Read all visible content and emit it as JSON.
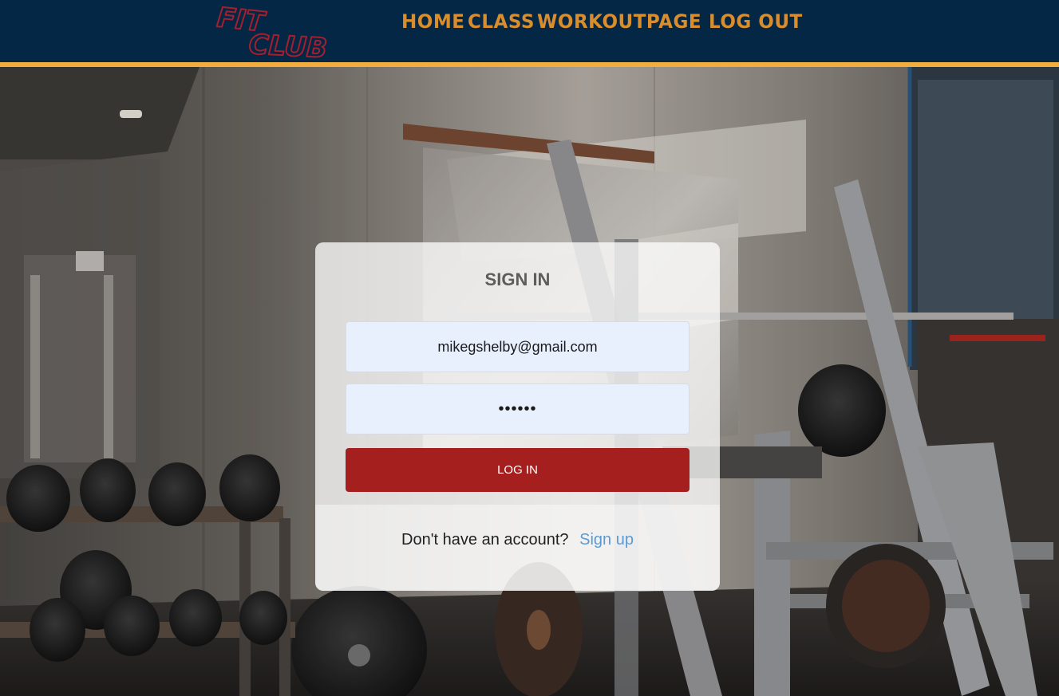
{
  "header": {
    "logo_text_line1": "FIT",
    "logo_text_line2": "CLUB",
    "nav": [
      {
        "label": "HOME"
      },
      {
        "label": "CLASS"
      },
      {
        "label": "WORKOUTPAGE"
      },
      {
        "label": "LOG OUT"
      }
    ]
  },
  "signin": {
    "title": "SIGN IN",
    "email_value": "mikegshelby@gmail.com",
    "password_value": "••••••",
    "login_label": "LOG IN",
    "no_account_text": "Don't have an account?",
    "signup_label": "Sign up"
  },
  "background": {
    "icon": "gym-background-image"
  },
  "colors": {
    "header_bg": "#032744",
    "header_border": "#f3ad3c",
    "nav_text": "#d98d2d",
    "logo": "#a51f2f",
    "login_button": "#a51f1f",
    "input_bg": "#e8f0fe",
    "signup_link": "#5b9bd5"
  }
}
